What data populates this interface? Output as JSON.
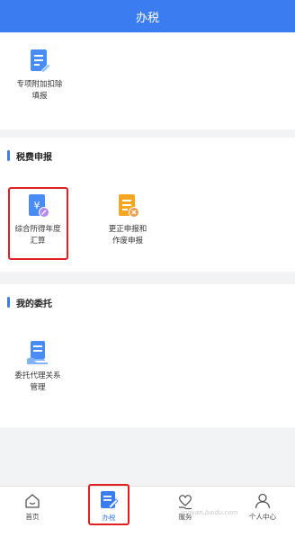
{
  "header": {
    "title": "办税"
  },
  "special": {
    "tile_label": "专项附加扣除\n填报"
  },
  "tax_filing": {
    "title": "税费申报",
    "tiles": [
      {
        "label": "综合所得年度\n汇算",
        "icon": "yen-document-icon"
      },
      {
        "label": "更正申报和\n作废申报",
        "icon": "document-cancel-icon"
      }
    ]
  },
  "entrust": {
    "title": "我的委托",
    "tile_label": "委托代理关系\n管理"
  },
  "tabbar": {
    "items": [
      {
        "label": "首页",
        "icon": "home-icon"
      },
      {
        "label": "办税",
        "icon": "tax-document-icon"
      },
      {
        "label": "服务",
        "icon": "heart-hand-icon"
      },
      {
        "label": "个人中心",
        "icon": "person-icon"
      }
    ]
  },
  "watermark": "jingyan.baidu.com",
  "colors": {
    "accent": "#3b7cf0",
    "highlight": "#e02020",
    "orange": "#f5a623"
  }
}
